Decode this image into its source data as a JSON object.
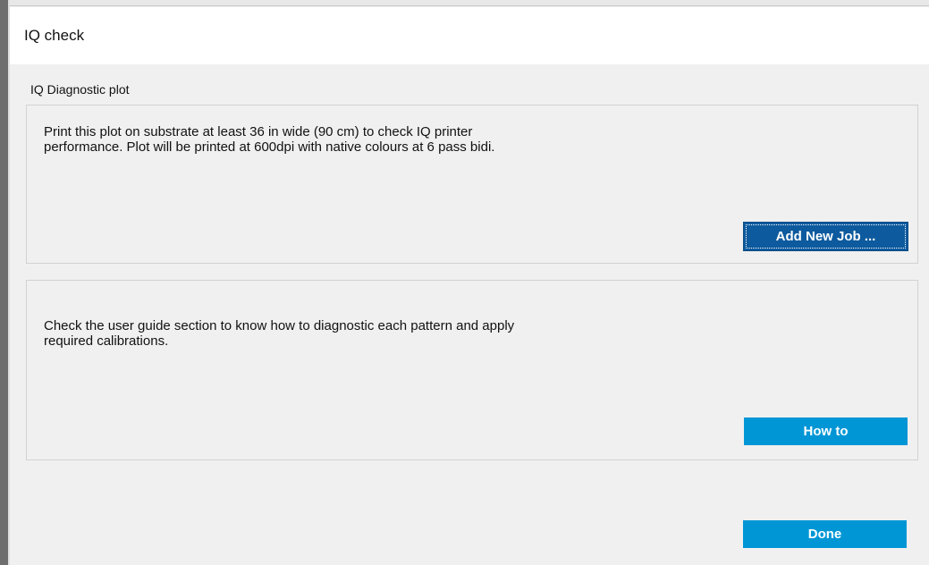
{
  "window": {
    "title": "IQ check"
  },
  "group": {
    "label": "IQ Diagnostic plot"
  },
  "panel_plot": {
    "text_line1": "Print this plot on substrate at least 36 in wide (90 cm) to check IQ printer",
    "text_line2": "performance. Plot will be printed at 600dpi with native colours at 6 pass bidi.",
    "button_label": "Add New Job ..."
  },
  "panel_guide": {
    "text_line1": "Check the user guide section to know how to diagnostic each pattern and apply",
    "text_line2": "required calibrations.",
    "button_label": "How to"
  },
  "footer": {
    "done_label": "Done"
  },
  "colors": {
    "button_blue": "#0096d6",
    "button_focused": "#0d5a9e",
    "background": "#f0f0f0"
  }
}
